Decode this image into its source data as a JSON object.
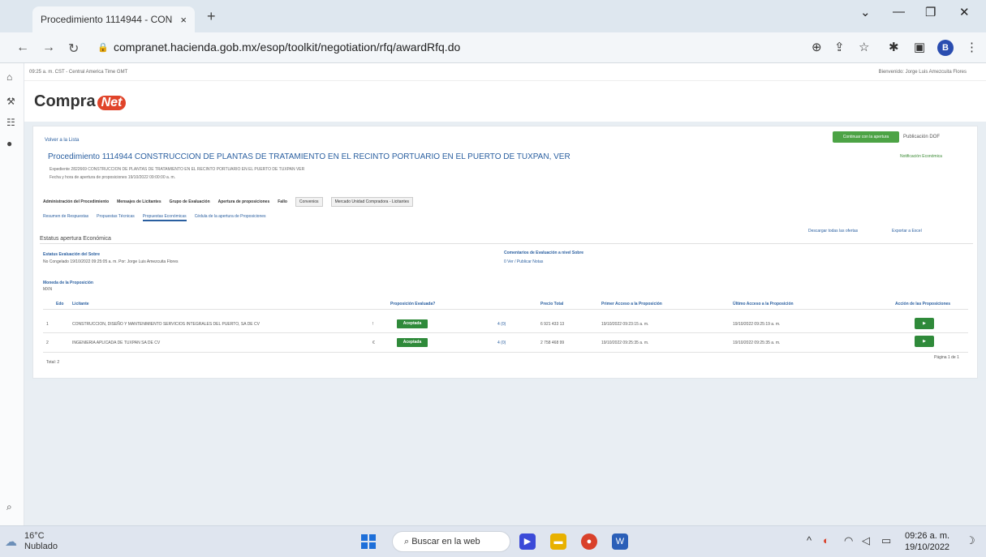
{
  "browser": {
    "tab_title": "Procedimiento 1114944 - CON",
    "tab_close": "×",
    "new_tab": "+",
    "url": "compranet.hacienda.gob.mx/esop/toolkit/negotiation/rfq/awardRfq.do",
    "profile_initial": "B"
  },
  "header": {
    "time_zone": "09:25 a. m. CST - Central America Time GMT",
    "user": "Bienvenido: Jorge Luis Amezcuita Flores",
    "logo_text": "Compra",
    "logo_net": "Net"
  },
  "procedure": {
    "back": "Volver a la Lista",
    "title": "Procedimiento 1114944 CONSTRUCCION DE PLANTAS DE TRATAMIENTO EN EL RECINTO PORTUARIO EN EL PUERTO DE TUXPAN, VER",
    "subtitle1": "Expediente 2822669 CONSTRUCCION DE PLANTAS DE TRATAMIENTO EN EL RECINTO PORTUARIO EN EL PUERTO DE TUXPAN VER",
    "subtitle2": "Fecha y hora de apertura de proposiciones 19/10/2022 09:00:00 a. m.",
    "action_button": "Continuar con la apertura",
    "publication": "Publicación DOF",
    "green_link": "Notificación Económica"
  },
  "tabs_main": [
    "Administración del Procedimiento",
    "Mensajes de Licitantes",
    "Grupo de Evaluación",
    "Apertura de proposiciones",
    "Fallo",
    "Convenios",
    "Mercado Unidad Compradora - Licitantes"
  ],
  "tabs_sub": [
    "Resumen de Respuestas",
    "Propuestas Técnicas",
    "Propuestas Económicas",
    "Cédula de la apertura de Proposiciones"
  ],
  "section": {
    "title": "Estatus apertura Económica",
    "right_link1": "Descargar todas las ofertas",
    "right_link2": "Exportar a Excel",
    "status_label": "Estatus Evaluación del Sobre",
    "status_value": "No Congelado 19/10/2022 09:25:05 a. m. Por: Jorge Luis Amezcuita Flores",
    "comments_label": "Comentarios de Evaluación a nivel Sobre",
    "comments_value": "0 Ver / Publicar Notas",
    "currency_label": "Moneda de la Proposición",
    "currency_value": "MXN"
  },
  "table": {
    "headers": [
      "Edo",
      "Licitante",
      "Proposición Evaluada?",
      "Precio Total",
      "Primer Acceso a la Proposición",
      "Último Acceso a la Proposición",
      "Acción de las Proposiciones"
    ],
    "rows": [
      {
        "num": "1",
        "name": "CONSTRUCCION, DISEÑO Y MANTENIMIENTO SERVICIOS INTEGRALES DEL PUERTO, SA DE CV",
        "flag": "!",
        "status": "Aceptada",
        "docs": "4 (0)",
        "total": "6 921 433 13",
        "first": "19/10/2022 09:23:15 a. m.",
        "last": "19/10/2022 09:25:19 a. m.",
        "action": "▶"
      },
      {
        "num": "2",
        "name": "INGENIERIA APLICADA DE TUXPAN SA DE CV",
        "flag": "€",
        "status": "Aceptada",
        "docs": "4 (0)",
        "total": "2 758 468 99",
        "first": "19/10/2022 09:25:35 a. m.",
        "last": "19/10/2022 09:25:35 a. m.",
        "action": "▶"
      }
    ],
    "total_label": "Total: 2",
    "pagination": "Página 1 de 1"
  },
  "taskbar": {
    "temp": "16°C",
    "weather": "Nublado",
    "search": "Buscar en la web",
    "time": "09:26 a. m.",
    "date": "19/10/2022"
  }
}
